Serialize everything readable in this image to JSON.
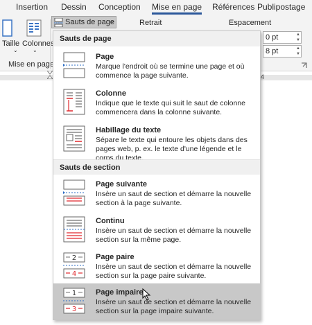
{
  "tabs": [
    {
      "label": "Insertion",
      "active": false
    },
    {
      "label": "Dessin",
      "active": false
    },
    {
      "label": "Conception",
      "active": false
    },
    {
      "label": "Mise en page",
      "active": true
    },
    {
      "label": "Références",
      "active": false
    },
    {
      "label": "Publipostage",
      "active": false
    }
  ],
  "ribbon": {
    "size_label": "Taille",
    "columns_label": "Colonnes",
    "group_label": "Mise en page",
    "breaks_button": "Sauts de page",
    "indent_label": "Retrait",
    "spacing_label": "Espacement",
    "spacing_before": "0 pt",
    "spacing_after": "8 pt",
    "ruler_number": "4"
  },
  "menu": {
    "page_breaks_title": "Sauts de page",
    "section_breaks_title": "Sauts de section",
    "items": [
      {
        "title": "Page",
        "desc": "Marque l'endroit où se termine une page et où commence la page suivante."
      },
      {
        "title": "Colonne",
        "desc": "Indique que le texte qui suit le saut de colonne commencera dans la colonne suivante."
      },
      {
        "title": "Habillage du texte",
        "desc": "Sépare le texte qui entoure les objets dans des pages web, p. ex. le texte d'une légende et le corps du texte."
      },
      {
        "title": "Page suivante",
        "desc": "Insère un saut de section et démarre la nouvelle section à la page suivante."
      },
      {
        "title": "Continu",
        "desc": "Insère un saut de section et démarre la nouvelle section sur la même page."
      },
      {
        "title": "Page paire",
        "desc": "Insère un saut de section et démarre la nouvelle section sur la page paire suivante."
      },
      {
        "title": "Page impaire",
        "desc": "Insère un saut de section et démarre la nouvelle section sur la page impaire suivante."
      }
    ],
    "icon_numbers": {
      "even_top": "2",
      "even_bottom": "4",
      "odd_top": "1",
      "odd_bottom": "3"
    }
  },
  "colors": {
    "accent": "#2b579a",
    "hover": "#c8c8c8",
    "break_line": "#e0282d",
    "blue_icon": "#2b6cc4"
  }
}
